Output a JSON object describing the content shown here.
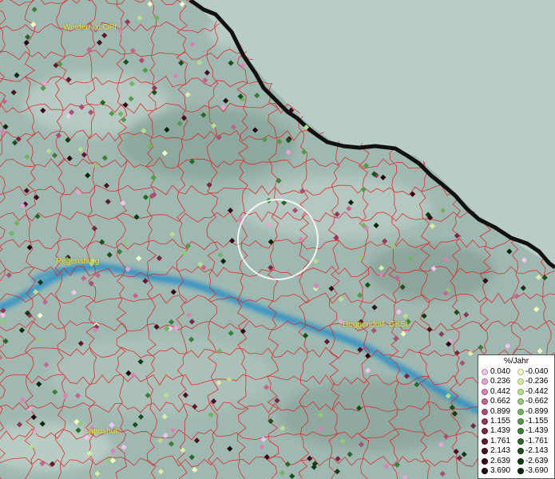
{
  "labels": [
    {
      "id": "weiden",
      "text": "Weiden i.d.OPf."
    },
    {
      "id": "regensburg",
      "text": "Regensburg"
    },
    {
      "id": "deggendorf",
      "text": "Deggendorf, GKSt"
    },
    {
      "id": "landshut",
      "text": "Landshut"
    }
  ],
  "legend": {
    "title": "%/Jahr",
    "positive": [
      {
        "value": "0.040",
        "color": "#f0c6ec"
      },
      {
        "value": "0.236",
        "color": "#e7a5d3"
      },
      {
        "value": "0.442",
        "color": "#d585b4"
      },
      {
        "value": "0.662",
        "color": "#c0678f"
      },
      {
        "value": "0.899",
        "color": "#a84f73"
      },
      {
        "value": "1.155",
        "color": "#8f3a5b"
      },
      {
        "value": "1.439",
        "color": "#762846"
      },
      {
        "value": "1.761",
        "color": "#5e1a33"
      },
      {
        "value": "2.143",
        "color": "#480f24"
      },
      {
        "value": "2.639",
        "color": "#330818"
      },
      {
        "value": "3.690",
        "color": "#20030d"
      }
    ],
    "negative": [
      {
        "value": "-0.040",
        "color": "#f3f7c0"
      },
      {
        "value": "-0.236",
        "color": "#d8eea6"
      },
      {
        "value": "-0.442",
        "color": "#b7dd8f"
      },
      {
        "value": "-0.662",
        "color": "#94c878"
      },
      {
        "value": "-0.899",
        "color": "#73b260"
      },
      {
        "value": "-1.155",
        "color": "#55984a"
      },
      {
        "value": "-1.439",
        "color": "#3d7e37"
      },
      {
        "value": "-1.761",
        "color": "#2a6628"
      },
      {
        "value": "-2.143",
        "color": "#1b4f1c"
      },
      {
        "value": "-2.639",
        "color": "#0f3a12"
      },
      {
        "value": "-3.690",
        "color": "#06260a"
      }
    ]
  },
  "colors": {
    "boundary": "#e02020",
    "border": "#111111",
    "river": "#2a8fc6",
    "label": "#f2e23a",
    "terrain": "#9fb9b2",
    "outside": "#b9cdc8"
  }
}
